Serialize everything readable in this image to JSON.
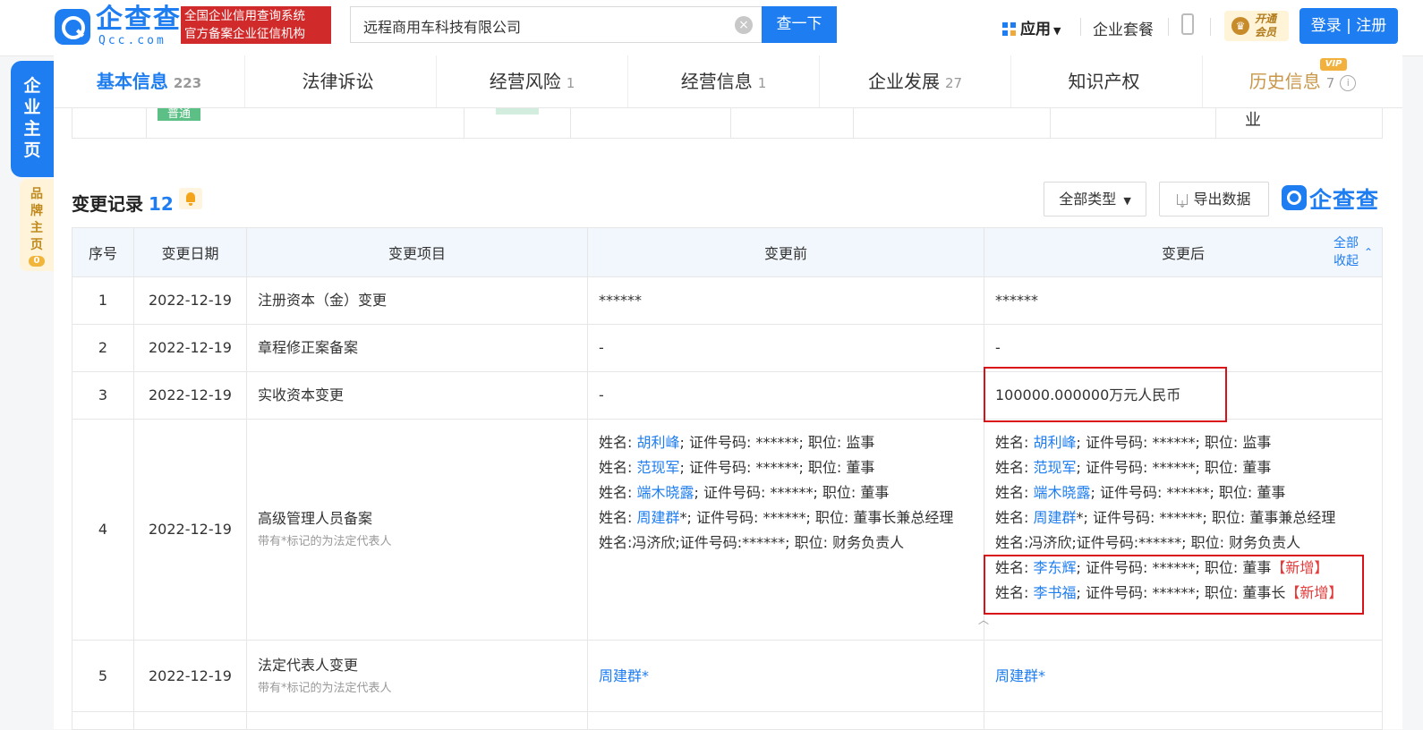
{
  "header": {
    "logo_text": "企查查",
    "logo_sub": "Qcc.com",
    "badge_line1": "全国企业信用查询系统",
    "badge_line2": "官方备案企业征信机构",
    "search_value": "远程商用车科技有限公司",
    "search_button": "查一下",
    "apps_label": "应用",
    "suite_label": "企业套餐",
    "vip_line1": "开通",
    "vip_line2": "会员",
    "login_label": "登录 | 注册"
  },
  "side": {
    "main_tab": [
      "企",
      "业",
      "主",
      "页"
    ],
    "brand_tab": [
      "品",
      "牌",
      "主",
      "页"
    ],
    "brand_count": "0"
  },
  "tabs": [
    {
      "label": "基本信息",
      "count": "223"
    },
    {
      "label": "法律诉讼",
      "count": ""
    },
    {
      "label": "经营风险",
      "count": "1"
    },
    {
      "label": "经营信息",
      "count": "1"
    },
    {
      "label": "企业发展",
      "count": "27"
    },
    {
      "label": "知识产权",
      "count": ""
    },
    {
      "label": "历史信息",
      "count": "7"
    }
  ],
  "vip_tag": "VIP",
  "prev_row": {
    "tag": "普通",
    "tail": "业"
  },
  "section": {
    "title": "变更记录",
    "count": "12",
    "type_button": "全部类型",
    "export_button": "导出数据",
    "watermark": "企查查"
  },
  "table": {
    "headers": [
      "序号",
      "变更日期",
      "变更项目",
      "变更前",
      "变更后"
    ],
    "collapse_line1": "全部",
    "collapse_line2": "收起",
    "legal_note": "带有*标记的为法定代表人",
    "rows": [
      {
        "no": "1",
        "date": "2022-12-19",
        "item": "注册资本（金）变更",
        "before": "******",
        "after": "******"
      },
      {
        "no": "2",
        "date": "2022-12-19",
        "item": "章程修正案备案",
        "before": "-",
        "after": "-"
      },
      {
        "no": "3",
        "date": "2022-12-19",
        "item": "实收资本变更",
        "before": "-",
        "after": "100000.000000万元人民币"
      },
      {
        "no": "4",
        "date": "2022-12-19",
        "item": "高级管理人员备案"
      },
      {
        "no": "5",
        "date": "2022-12-19",
        "item": "法定代表人变更",
        "before": "周建群*",
        "after": "周建群*"
      }
    ],
    "row4_before": [
      {
        "pre": "姓名: ",
        "name": "胡利峰",
        "post": "; 证件号码: ******; 职位: 监事"
      },
      {
        "pre": "姓名: ",
        "name": "范现军",
        "post": "; 证件号码: ******; 职位: 董事"
      },
      {
        "pre": "姓名: ",
        "name": "端木晓露",
        "post": "; 证件号码: ******; 职位: 董事"
      },
      {
        "pre": "姓名: ",
        "name": "周建群",
        "post": "*; 证件号码: ******; 职位: 董事长兼总经理"
      },
      {
        "pre": "姓名:冯济欣;证件号码:******; 职位: 财务负责人",
        "name": "",
        "post": ""
      }
    ],
    "row4_after": [
      {
        "pre": "姓名: ",
        "name": "胡利峰",
        "post": "; 证件号码: ******; 职位: 监事",
        "tag": ""
      },
      {
        "pre": "姓名: ",
        "name": "范现军",
        "post": "; 证件号码: ******; 职位: 董事",
        "tag": ""
      },
      {
        "pre": "姓名: ",
        "name": "端木晓露",
        "post": "; 证件号码: ******; 职位: 董事",
        "tag": ""
      },
      {
        "pre": "姓名: ",
        "name": "周建群",
        "post": "*; 证件号码: ******; 职位: 董事兼总经理",
        "tag": ""
      },
      {
        "pre": "姓名:冯济欣;证件号码:******; 职位: 财务负责人",
        "name": "",
        "post": "",
        "tag": ""
      },
      {
        "pre": "姓名: ",
        "name": "李东辉",
        "post": "; 证件号码: ******; 职位: 董事",
        "tag": "【新增】"
      },
      {
        "pre": "姓名: ",
        "name": "李书福",
        "post": "; 证件号码: ******; 职位: 董事长",
        "tag": "【新增】"
      }
    ]
  },
  "colors": {
    "brand_blue": "#1e7df0",
    "highlight_red": "#d9121a",
    "new_tag_red": "#e33b3b",
    "vip_gold": "#c9974a"
  },
  "icons": [
    "apps-grid-icon",
    "clear-icon",
    "phone-icon",
    "crown-icon",
    "bell-icon",
    "export-icon",
    "info-icon",
    "chevron-up-icon"
  ]
}
